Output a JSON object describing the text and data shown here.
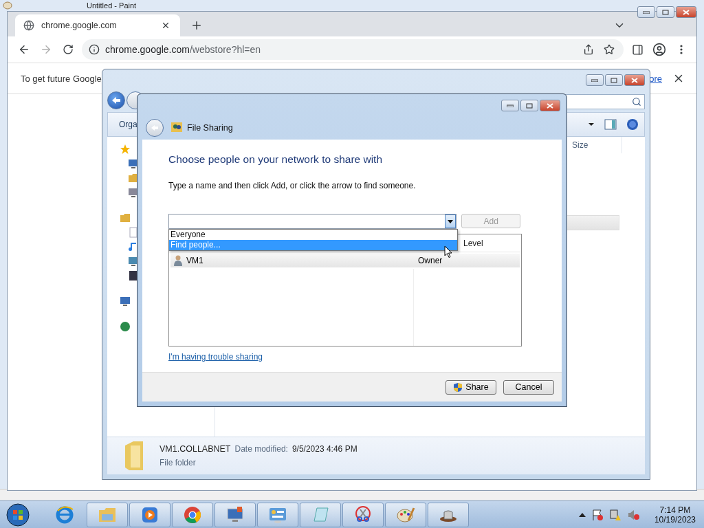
{
  "paint_window": {
    "title": "Untitled - Paint"
  },
  "browser": {
    "tab": {
      "title": "chrome.google.com",
      "selected": true
    },
    "address": {
      "domain": "chrome.google.com",
      "path": "/webstore?hl=en"
    },
    "infobar": {
      "text": "To get future Google",
      "link": "ore"
    }
  },
  "explorer": {
    "toolbar": {
      "organize": "Orga"
    },
    "columns": [
      "Size"
    ],
    "details": {
      "name": "VM1.COLLABNET",
      "date_label": "Date modified:",
      "date": "9/5/2023 4:46 PM",
      "type": "File folder"
    }
  },
  "dialog": {
    "title": "File Sharing",
    "heading": "Choose people on your network to share with",
    "instruction": "Type a name and then click Add, or click the arrow to find someone.",
    "add_button": {
      "label": "Add",
      "disabled": true
    },
    "dropdown": [
      {
        "label": "Everyone",
        "selected": false
      },
      {
        "label": "Find people...",
        "selected": true
      }
    ],
    "list": {
      "columns": [
        "Level"
      ],
      "rows": [
        {
          "name": "VM1",
          "level": "Owner"
        }
      ]
    },
    "link": "I'm having trouble sharing",
    "buttons": [
      {
        "label": "Share",
        "kind": "elevated"
      },
      {
        "label": "Cancel",
        "kind": "plain"
      }
    ]
  },
  "taskbar": {
    "apps": [
      {
        "kind": "internet-explorer",
        "running": false
      },
      {
        "kind": "file-explorer",
        "running": true
      },
      {
        "kind": "media-player",
        "running": true
      },
      {
        "kind": "chrome",
        "running": true
      },
      {
        "kind": "remote-desktop",
        "running": true
      },
      {
        "kind": "control-panel",
        "running": true
      },
      {
        "kind": "notepad",
        "running": true
      },
      {
        "kind": "snipping-tool",
        "running": true
      },
      {
        "kind": "paint",
        "running": true
      },
      {
        "kind": "hat",
        "running": true
      }
    ],
    "clock": {
      "time": "7:14 PM",
      "date": "10/19/2023"
    }
  }
}
